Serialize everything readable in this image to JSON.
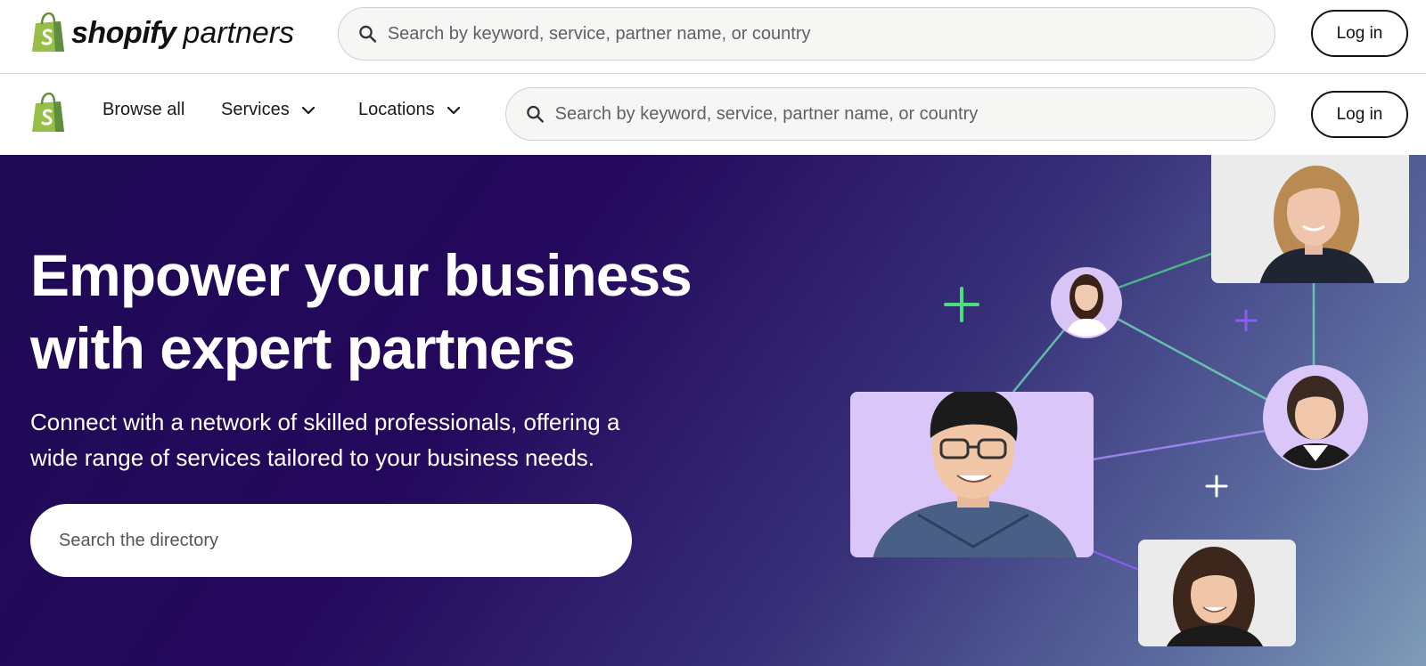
{
  "brand": {
    "word_bold": "shopify",
    "word_light": "partners",
    "logo_icon": "shopify-bag-icon",
    "brand_green": "#95bf47",
    "brand_green_dark": "#5e8e3e"
  },
  "top_header": {
    "search_placeholder": "Search by keyword, service, partner name, or country",
    "login_label": "Log in"
  },
  "nav": {
    "items": [
      {
        "label": "Browse all",
        "has_dropdown": false
      },
      {
        "label": "Services",
        "has_dropdown": true
      },
      {
        "label": "Locations",
        "has_dropdown": true
      }
    ],
    "search_placeholder": "Search by keyword, service, partner name, or country",
    "login_label": "Log in"
  },
  "hero": {
    "title_line1": "Empower your business",
    "title_line2": "with expert partners",
    "subtitle_line1": "Connect with a network of skilled professionals, offering a",
    "subtitle_line2": "wide range of services tailored to your business needs.",
    "search_placeholder": "Search the directory",
    "background_colors": [
      "#1e0b55",
      "#372f78",
      "#7e9cb8"
    ],
    "accent_green": "#4ade80",
    "accent_purple": "#8b5cf6",
    "partner_photos": [
      "partner-photo-woman-blonde",
      "partner-photo-woman-small-circle",
      "partner-photo-man-glasses",
      "partner-photo-woman-short-hair",
      "partner-photo-woman-curly-hair"
    ]
  }
}
